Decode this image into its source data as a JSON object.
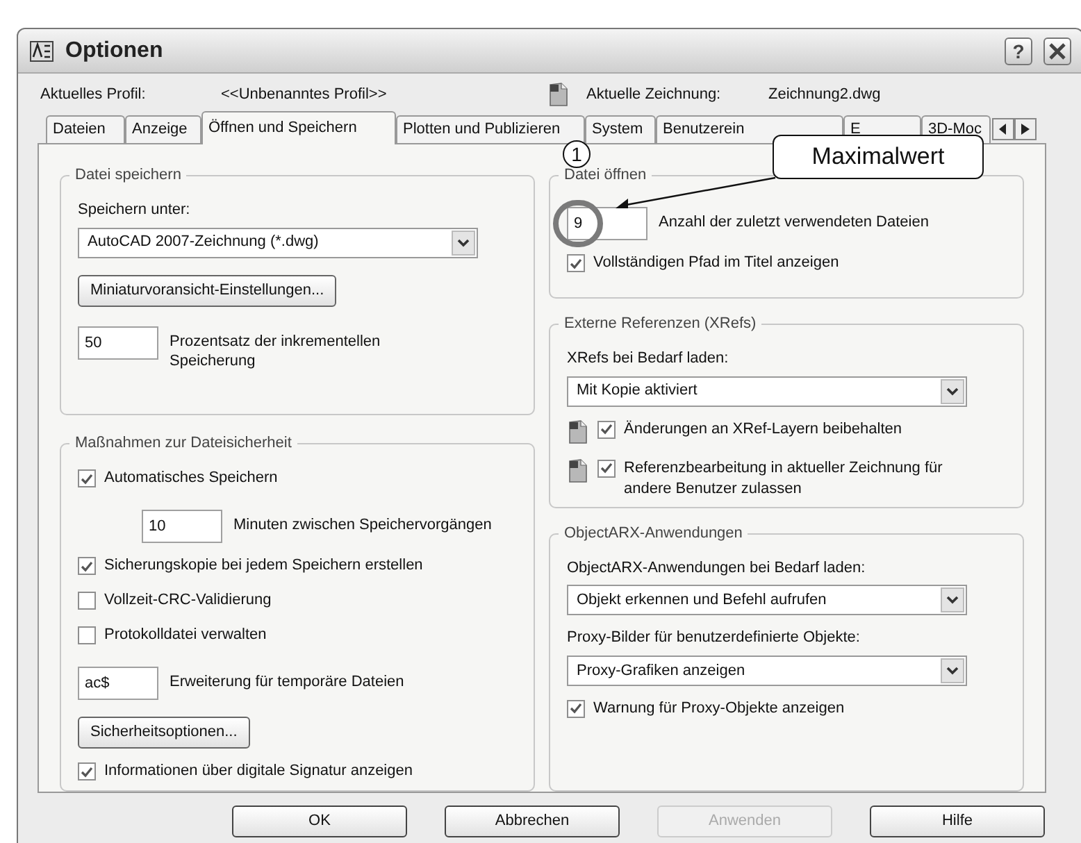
{
  "window": {
    "title": "Optionen",
    "help": "?"
  },
  "profile": {
    "label": "Aktuelles Profil:",
    "value": "<<Unbenanntes Profil>>",
    "drawing_label": "Aktuelle Zeichnung:",
    "drawing_value": "Zeichnung2.dwg"
  },
  "tabs": [
    {
      "label": "Dateien",
      "selected": false
    },
    {
      "label": "Anzeige",
      "selected": false
    },
    {
      "label": "Öffnen und Speichern",
      "selected": true
    },
    {
      "label": "Plotten und Publizieren",
      "selected": false
    },
    {
      "label": "System",
      "selected": false
    },
    {
      "label": "Benutzerein",
      "selected": false
    },
    {
      "label": "E",
      "selected": false
    },
    {
      "label": "3D-Moc",
      "selected": false
    }
  ],
  "annotations": {
    "step_marker": "1",
    "callout": "Maximalwert"
  },
  "left_groups": [
    {
      "title": "Datei speichern",
      "items": [
        {
          "kind": "label",
          "text": "Speichern unter:"
        },
        {
          "kind": "dropdown",
          "value": "AutoCAD 2007-Zeichnung (*.dwg)"
        },
        {
          "kind": "button",
          "label": "Miniaturvoransicht-Einstellungen..."
        },
        {
          "kind": "number",
          "value": "50",
          "caption": "Prozentsatz der inkrementellen\nSpeicherung"
        }
      ]
    },
    {
      "title": "Maßnahmen zur Dateisicherheit",
      "items": [
        {
          "kind": "checkbox",
          "label": "Automatisches Speichern",
          "checked": true
        },
        {
          "kind": "number",
          "value": "10",
          "caption": "Minuten zwischen Speichervorgängen",
          "indent": true
        },
        {
          "kind": "checkbox",
          "label": "Sicherungskopie bei jedem Speichern erstellen",
          "checked": true
        },
        {
          "kind": "checkbox",
          "label": "Vollzeit-CRC-Validierung",
          "checked": false
        },
        {
          "kind": "checkbox",
          "label": "Protokolldatei verwalten",
          "checked": false
        },
        {
          "kind": "number",
          "value": "ac$",
          "caption": "Erweiterung für temporäre Dateien"
        },
        {
          "kind": "button",
          "label": "Sicherheitsoptionen..."
        },
        {
          "kind": "checkbox",
          "label": "Informationen über digitale Signatur anzeigen",
          "checked": true
        }
      ]
    }
  ],
  "right_groups": [
    {
      "title": "Datei öffnen",
      "items": [
        {
          "kind": "number",
          "value": "9",
          "caption": "Anzahl der zuletzt verwendeten Dateien",
          "highlighted": true
        },
        {
          "kind": "checkbox",
          "label": "Vollständigen Pfad im Titel anzeigen",
          "checked": true
        }
      ]
    },
    {
      "title": "Externe Referenzen (XRefs)",
      "items": [
        {
          "kind": "label",
          "text": "XRefs bei Bedarf laden:"
        },
        {
          "kind": "dropdown",
          "value": "Mit Kopie aktiviert"
        },
        {
          "kind": "icon_checkbox",
          "label": "Änderungen an XRef-Layern beibehalten",
          "checked": true
        },
        {
          "kind": "icon_checkbox",
          "label": "Referenzbearbeitung in aktueller Zeichnung für andere Benutzer zulassen",
          "checked": true
        }
      ]
    },
    {
      "title": "ObjectARX-Anwendungen",
      "items": [
        {
          "kind": "label",
          "text": "ObjectARX-Anwendungen bei Bedarf laden:"
        },
        {
          "kind": "dropdown",
          "value": "Objekt erkennen und Befehl aufrufen"
        },
        {
          "kind": "label",
          "text": "Proxy-Bilder für benutzerdefinierte Objekte:"
        },
        {
          "kind": "dropdown",
          "value": "Proxy-Grafiken anzeigen"
        },
        {
          "kind": "checkbox",
          "label": "Warnung für Proxy-Objekte anzeigen",
          "checked": true
        }
      ]
    }
  ],
  "buttons": [
    {
      "label": "OK",
      "disabled": false
    },
    {
      "label": "Abbrechen",
      "disabled": false
    },
    {
      "label": "Anwenden",
      "disabled": true
    },
    {
      "label": "Hilfe",
      "disabled": false
    }
  ]
}
